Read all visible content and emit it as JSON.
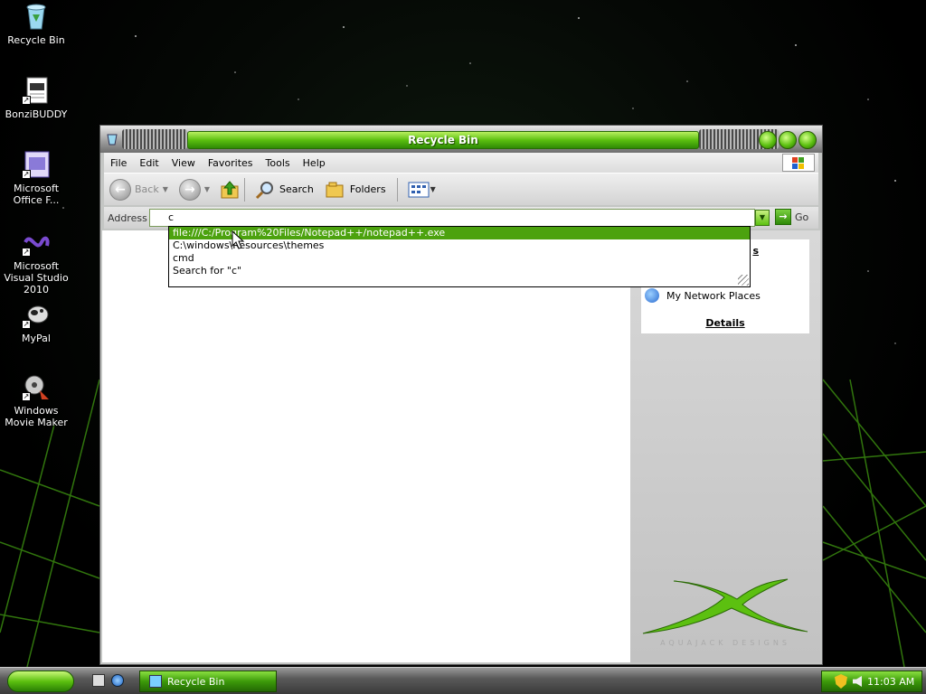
{
  "desktop": {
    "icons": [
      {
        "label": "Recycle Bin",
        "icon": "recycle-bin-icon"
      },
      {
        "label": "BonziBUDDY",
        "icon": "bonzibuddy-icon"
      },
      {
        "label": "Microsoft Office F...",
        "icon": "office-icon"
      },
      {
        "label": "Microsoft Visual Studio 2010",
        "icon": "visual-studio-icon"
      },
      {
        "label": "MyPal",
        "icon": "mypal-icon"
      },
      {
        "label": "Windows Movie Maker",
        "icon": "movie-maker-icon"
      }
    ]
  },
  "window": {
    "title": "Recycle Bin",
    "menu": [
      "File",
      "Edit",
      "View",
      "Favorites",
      "Tools",
      "Help"
    ],
    "toolbar": {
      "back": "Back",
      "search": "Search",
      "folders": "Folders"
    },
    "address": {
      "label": "Address",
      "value": "c",
      "go": "Go"
    },
    "autocomplete": [
      "file:///C:/Program%20Files/Notepad++/notepad++.exe",
      "C:\\windows\\Resources\\themes",
      "cmd",
      "Search for \"c\""
    ],
    "taskpane": {
      "partial_heading": "s",
      "network_places": "My Network Places",
      "details": "Details",
      "brand": "AQUAJACK DESIGNS"
    }
  },
  "taskbar": {
    "task": "Recycle Bin",
    "clock": "11:03 AM"
  },
  "colors": {
    "accent": "#5cc010",
    "selection": "#4ca20e"
  }
}
